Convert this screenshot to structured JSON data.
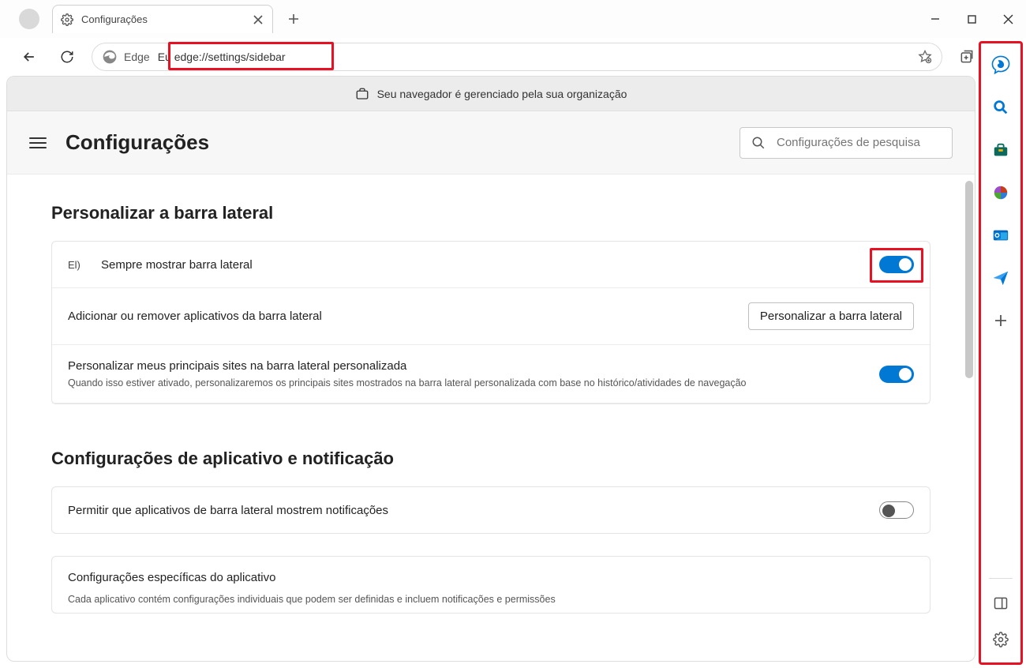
{
  "chrome": {
    "tab_title": "Configurações",
    "address_brand": "Edge",
    "address_prefix": "Eu",
    "address_url": "edge://settings/sidebar"
  },
  "banner": {
    "text": "Seu navegador é gerenciado pela sua organização"
  },
  "header": {
    "title": "Configurações",
    "search_placeholder": "Configurações de pesquisa"
  },
  "section1": {
    "title": "Personalizar a barra lateral",
    "row1_prefix": "El)",
    "row1_label": "Sempre mostrar barra lateral",
    "row2_label": "Adicionar ou remover aplicativos da barra lateral",
    "row2_button": "Personalizar a barra lateral",
    "row3_label": "Personalizar meus principais sites na barra lateral personalizada",
    "row3_sub": "Quando isso estiver ativado, personalizaremos os principais sites mostrados na barra lateral personalizada com base no histórico/atividades de navegação"
  },
  "section2": {
    "title": "Configurações de aplicativo e notificação",
    "row1_label": "Permitir que aplicativos de barra lateral mostrem notificações",
    "row2_label": "Configurações específicas do aplicativo",
    "row2_sub": "Cada aplicativo contém configurações individuais que podem ser definidas e incluem notificações e permissões"
  }
}
